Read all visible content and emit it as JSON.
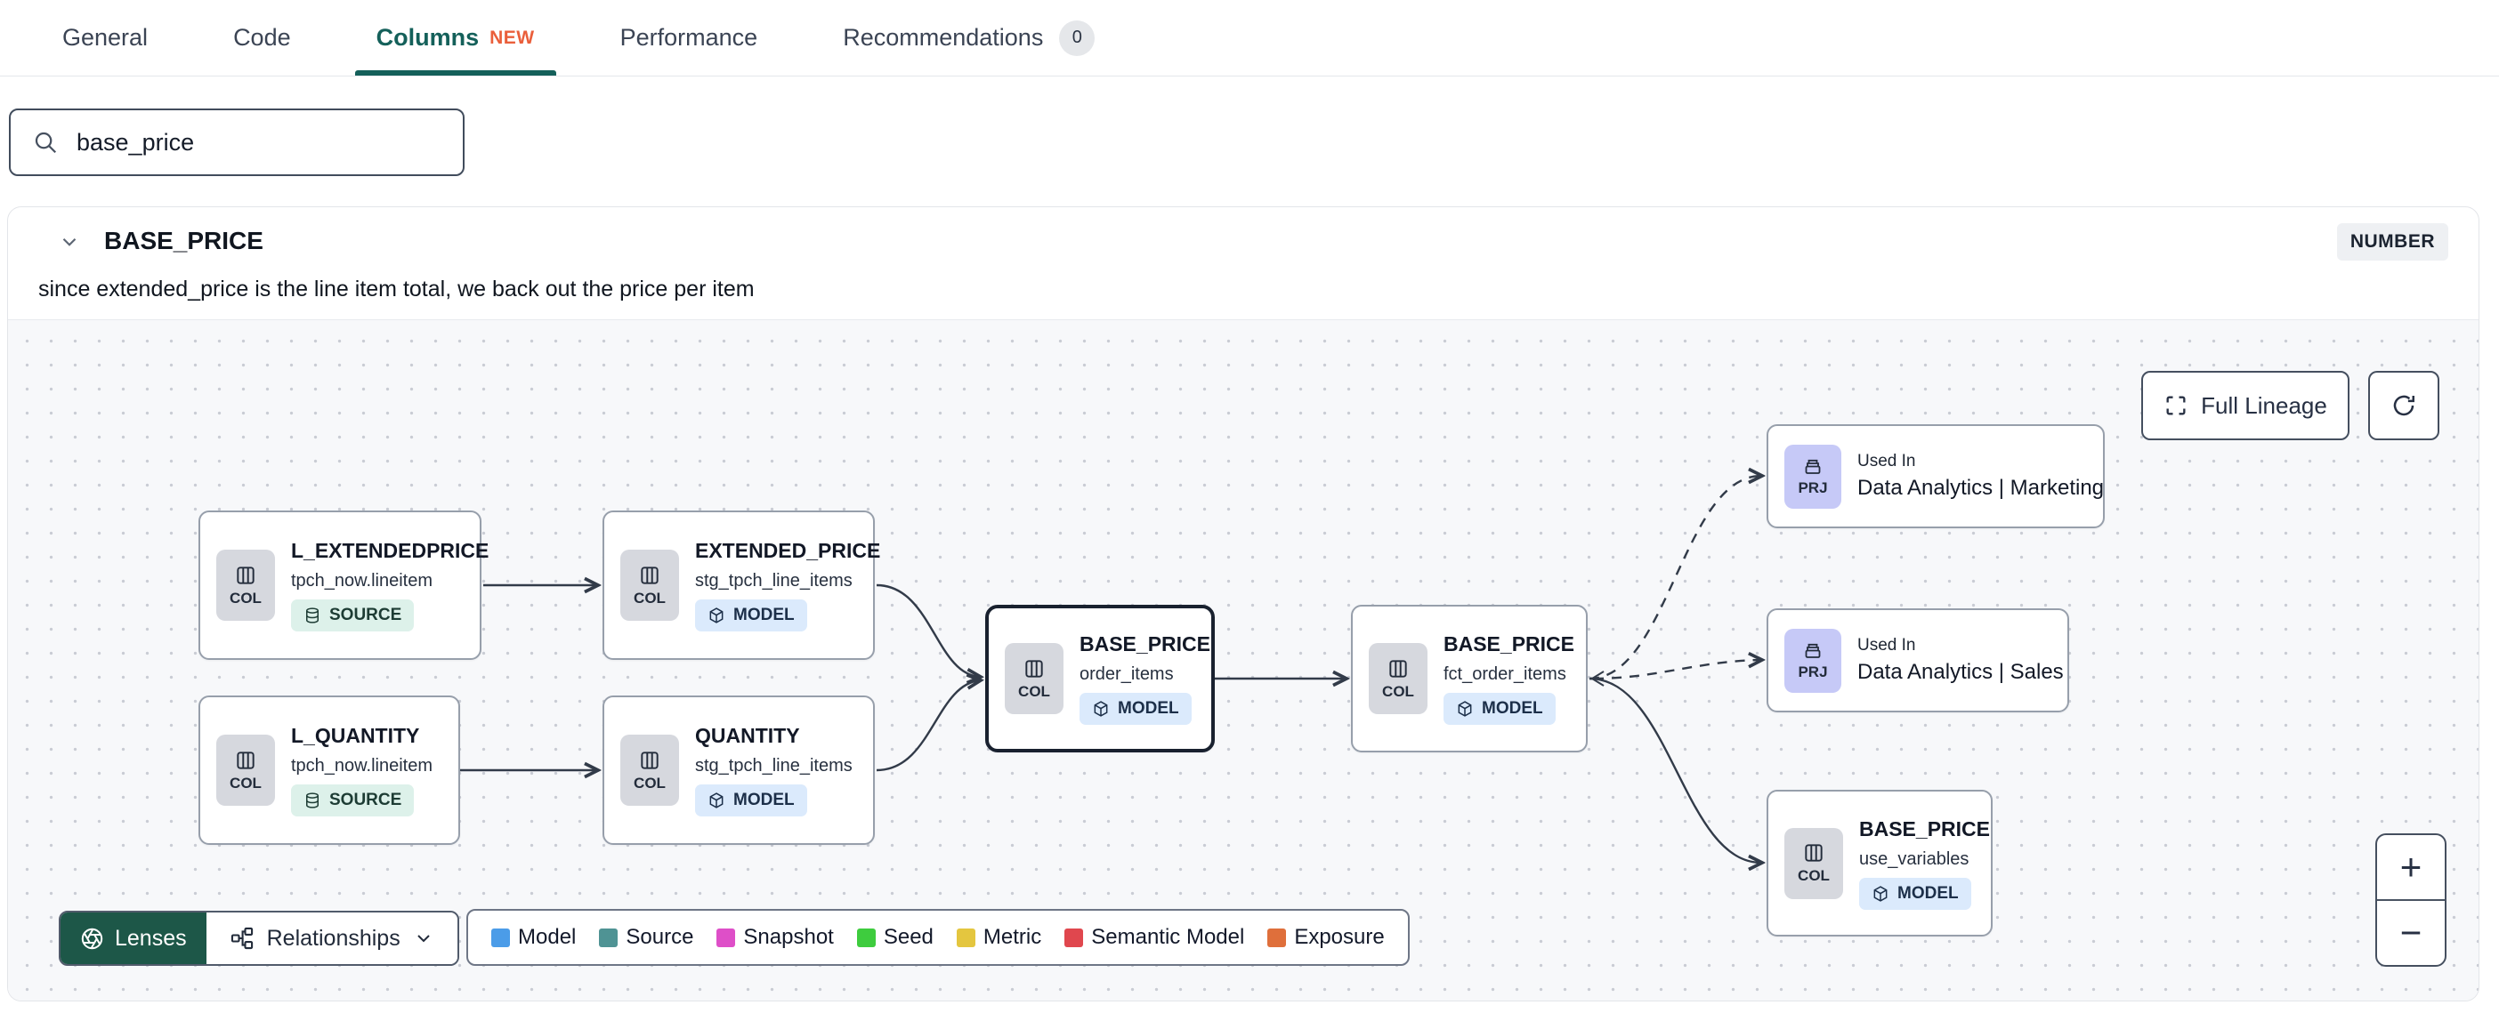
{
  "header_tabs": {
    "items": [
      {
        "label": "General"
      },
      {
        "label": "Code"
      },
      {
        "label": "Columns",
        "badge": "NEW"
      },
      {
        "label": "Performance"
      },
      {
        "label": "Recommendations",
        "count": "0"
      }
    ]
  },
  "search": {
    "value": "base_price"
  },
  "column_details": {
    "name": "BASE_PRICE",
    "data_type": "NUMBER",
    "description": "since extended_price is the line item total, we back out the price per item"
  },
  "lineage": {
    "controls": {
      "full_lineage": "Full Lineage",
      "zoom_in": "+",
      "zoom_out": "−"
    },
    "toolbar": {
      "lenses": "Lenses",
      "relationships": "Relationships"
    },
    "legend": [
      {
        "label": "Model",
        "color": "#4b9ce8"
      },
      {
        "label": "Source",
        "color": "#4f9394"
      },
      {
        "label": "Snapshot",
        "color": "#de4fc8"
      },
      {
        "label": "Seed",
        "color": "#3ecc3e"
      },
      {
        "label": "Metric",
        "color": "#e4c63f"
      },
      {
        "label": "Semantic Model",
        "color": "#e0474e"
      },
      {
        "label": "Exposure",
        "color": "#df6f3b"
      }
    ],
    "nodes": [
      {
        "kind": "COL",
        "title": "L_EXTENDEDPRICE",
        "subtitle": "tpch_now.lineitem",
        "badge": "SOURCE"
      },
      {
        "kind": "COL",
        "title": "EXTENDED_PRICE",
        "subtitle": "stg_tpch_line_items",
        "badge": "MODEL"
      },
      {
        "kind": "COL",
        "title": "L_QUANTITY",
        "subtitle": "tpch_now.lineitem",
        "badge": "SOURCE"
      },
      {
        "kind": "COL",
        "title": "QUANTITY",
        "subtitle": "stg_tpch_line_items",
        "badge": "MODEL"
      },
      {
        "kind": "COL",
        "title": "BASE_PRICE",
        "subtitle": "order_items",
        "badge": "MODEL"
      },
      {
        "kind": "COL",
        "title": "BASE_PRICE",
        "subtitle": "fct_order_items",
        "badge": "MODEL"
      },
      {
        "kind": "PRJ",
        "eyebrow": "Used In",
        "title": "Data Analytics | Marketing"
      },
      {
        "kind": "PRJ",
        "eyebrow": "Used In",
        "title": "Data Analytics | Sales"
      },
      {
        "kind": "COL",
        "title": "BASE_PRICE",
        "subtitle": "use_variables",
        "badge": "MODEL"
      }
    ]
  }
}
